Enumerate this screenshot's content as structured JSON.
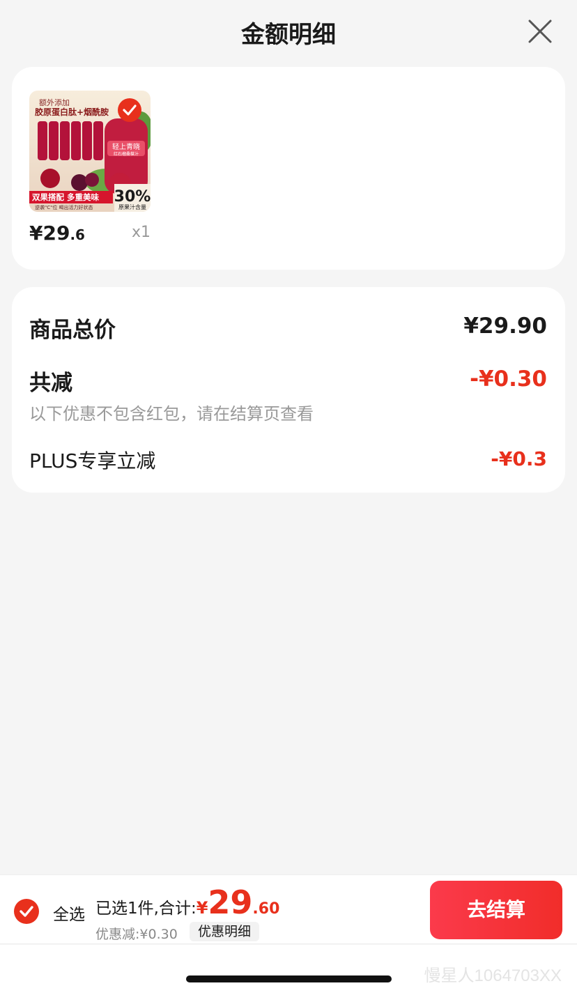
{
  "header": {
    "title": "金额明细"
  },
  "product": {
    "image_texts": {
      "tag": "额外添加",
      "headline": "胶原蛋白肽+烟酰胺",
      "bottle_text": "轻上青晓",
      "bottle_sub": "红石榴桑椹汁",
      "banner": "双果搭配 多重美味",
      "slogan": "逆袭\"C\"位 喝出活力好状态",
      "percent": "30%",
      "percent_label": "原果汁含量"
    },
    "price_int": "¥29",
    "price_dec": ".6",
    "quantity": "x1"
  },
  "price_detail": {
    "total_label": "商品总价",
    "total_value": "¥29.90",
    "reduction_label": "共减",
    "reduction_value": "-¥0.30",
    "reduction_note": "以下优惠不包含红包，请在结算页查看",
    "plus_label": "PLUS专享立减",
    "plus_value": "-¥0.3"
  },
  "footer": {
    "select_all": "全选",
    "summary_prefix": "已选1件,合计:",
    "total_currency": "¥",
    "total_int": "29",
    "total_dec": ".60",
    "discount_text": "优惠减:¥0.30",
    "detail_link": "优惠明细",
    "checkout": "去结算"
  },
  "watermark": "慢星人1064703XX",
  "colors": {
    "accent": "#e8301c",
    "button_start": "#fb3a4b",
    "button_end": "#f12d2a"
  }
}
